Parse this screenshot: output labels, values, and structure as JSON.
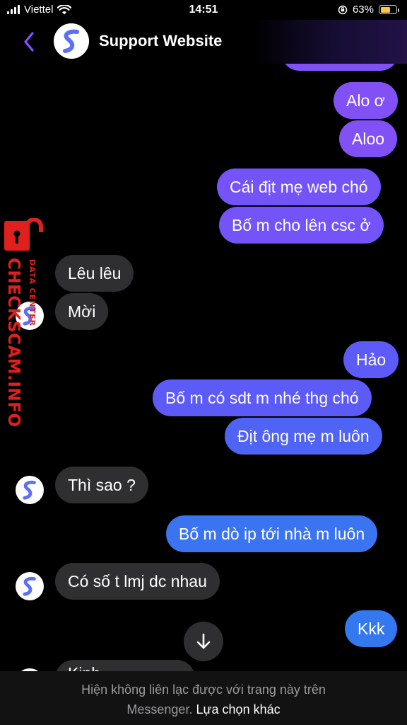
{
  "status_bar": {
    "carrier": "Viettel",
    "time": "14:51",
    "battery": "63%",
    "battery_level": 0.63
  },
  "header": {
    "title": "Support Website",
    "back_icon": "chevron-left-icon",
    "avatar_icon": "messenger-s-logo-icon"
  },
  "messages": {
    "out_1": "Alo ơ",
    "out_2": "Aloo",
    "out_3": "Cái địt mẹ web chó",
    "out_4": "Bố m cho lên csc ở",
    "in_1": "Lêu lêu",
    "in_2": "Mời",
    "out_5": "Hảo",
    "out_6": "Bố m có sdt m nhé thg chó",
    "out_7": "Địt ông mẹ m luôn",
    "in_3": "Thì sao ?",
    "out_8": "Bố m dò ip tới nhà m luôn",
    "in_4": "Có số t lmj dc nhau",
    "out_9": "Kkk",
    "in_5_partial": "Kinh..."
  },
  "watermark": {
    "main": "CHECKSCAM.INFO",
    "sub": "DATA CENTER",
    "icon": "lock-icon"
  },
  "footer": {
    "notice": "Hiện không liên lạc được với trang này trên Messenger.",
    "notice_line1": "Hiện không liên lạc được với trang này trên",
    "notice_line2": "Messenger.",
    "link": "Lựa chọn khác"
  },
  "colors": {
    "outgoing_top": "#8251f5",
    "outgoing_bottom": "#3378ee",
    "incoming": "#2f2f31",
    "watermark": "#e0201e"
  }
}
